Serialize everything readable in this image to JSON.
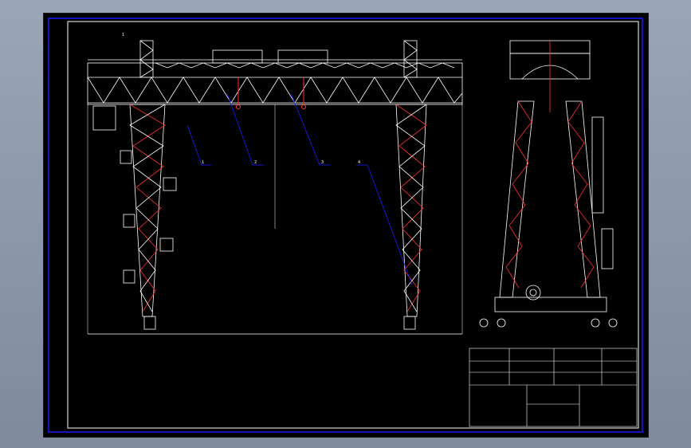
{
  "drawing": {
    "scale_label": "1",
    "title_block_text": "",
    "notes": {
      "heading": "",
      "lines": [
        "",
        "",
        ""
      ]
    },
    "callouts": [
      "1",
      "2",
      "3",
      "4"
    ],
    "dimension_center": "",
    "dimension_left": "",
    "dimension_right": ""
  },
  "colors": {
    "sheet_bg": "#000000",
    "frame": "#1a1aff",
    "structure": "#ffffff",
    "truss_red": "#ff3030",
    "viewport_bg": "#8e9aab"
  }
}
